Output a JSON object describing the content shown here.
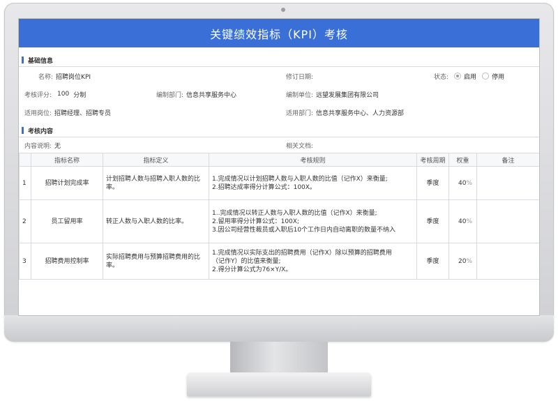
{
  "header": {
    "title": "关键绩效指标（KPI）考核"
  },
  "basic_info": {
    "section_title": "基础信息",
    "name_label": "名称:",
    "name_value": "招聘岗位KPI",
    "revision_date_label": "修订日期:",
    "revision_date_value": "",
    "status_label": "状态:",
    "status_options": [
      "启用",
      "停用"
    ],
    "status_selected": "启用",
    "score_label": "考核评分:",
    "score_value": "100",
    "score_unit": "分制",
    "dept_label": "编制部门:",
    "dept_value": "信息共享服务中心",
    "unit_label": "编制单位:",
    "unit_value": "远望发展集团有限公司",
    "post_label": "适用岗位:",
    "post_value": "招聘经理、招聘专员",
    "applicable_dept_label": "适用部门:",
    "applicable_dept_value": "信息共享服务中心、人力资源部"
  },
  "assessment": {
    "section_title": "考核内容",
    "desc_label": "内容说明:",
    "desc_value": "无",
    "docs_label": "相关文档:",
    "docs_value": ""
  },
  "table": {
    "headers": [
      "",
      "指标名称",
      "指标定义",
      "考核规则",
      "考核周期",
      "权重",
      "备注"
    ],
    "rows": [
      {
        "no": "1",
        "name": "招聘计划完成率",
        "definition": [
          "计划招聘人数与招聘入职人数的比",
          "率。"
        ],
        "rules": [
          "1.完成情况以计划招聘人数与入职人数的比值（记作X）来衡量;",
          "2.招聘达成率得分计算公式：100X。"
        ],
        "period": "季度",
        "weight": "40",
        "pct": "%",
        "note": ""
      },
      {
        "no": "2",
        "name": "员工留用率",
        "definition": [
          "转正人数与入职人数的比率。"
        ],
        "rules": [
          "1..完成情况以转正人数与入职人数的比值（记作X）来衡量;",
          "2.留用率得分计算公式：100X;",
          "3.因公司经营性裁员或入职后10个工作日内自动离职的数量不纳入"
        ],
        "period": "季度",
        "weight": "40",
        "pct": "%",
        "note": ""
      },
      {
        "no": "3",
        "name": "招聘费用控制率",
        "definition": [
          "实际招聘费用与预算招聘费用的比",
          "率。"
        ],
        "rules": [
          "1.完成情况以实际支出的招聘费用（记作X）除以预算的招聘费用",
          "（记作Y）的比值来衡量;",
          "2.得分计算公式为76×Y/X。"
        ],
        "period": "季度",
        "weight": "20",
        "pct": "%",
        "note": ""
      }
    ]
  }
}
